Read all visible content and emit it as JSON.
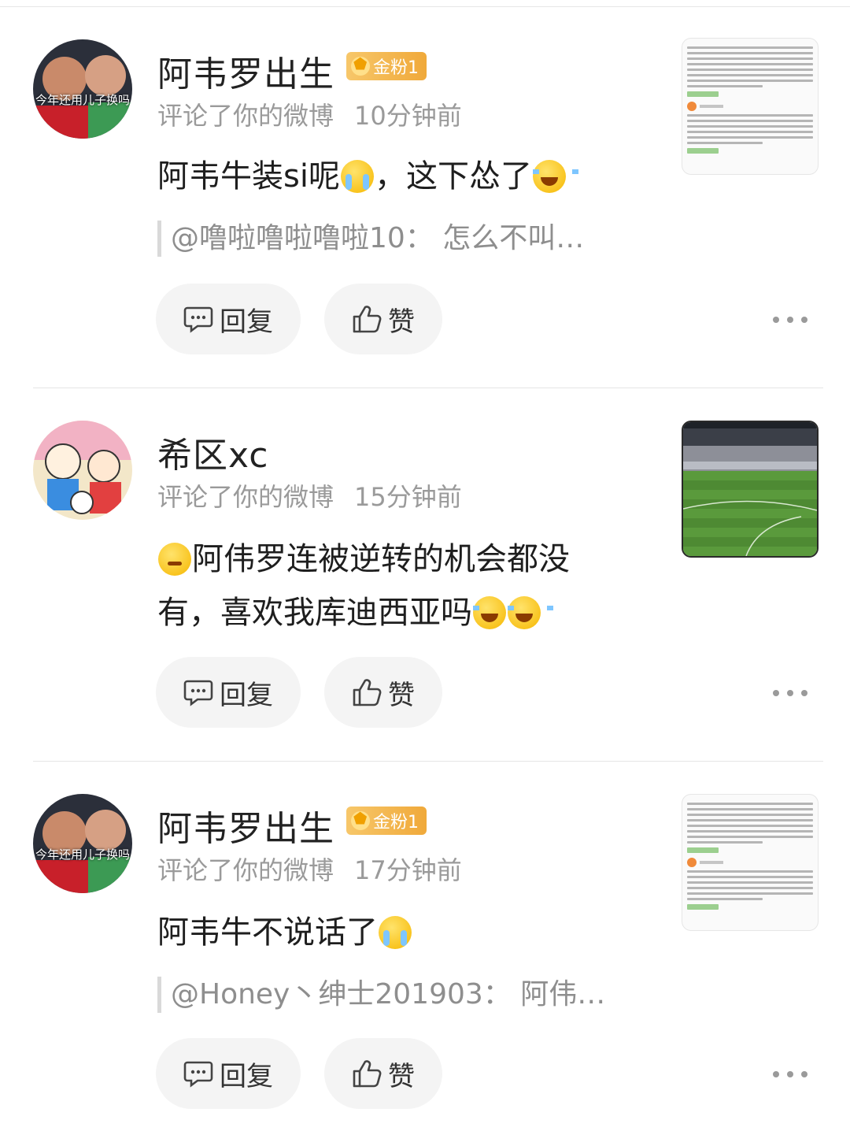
{
  "comments": [
    {
      "username": "阿韦罗出生",
      "badge": "金粉1",
      "action": "评论了你的微博",
      "time": "10分钟前",
      "text_parts": [
        "阿韦牛装si呢",
        "，这下怂了"
      ],
      "quote": "@噜啦噜啦噜啦10：  怎么不叫…",
      "avatar_caption": "今年还用儿子换吗"
    },
    {
      "username": "希区xc",
      "action": "评论了你的微博",
      "time": "15分钟前",
      "text_parts": [
        "阿伟罗连被逆转的机会都没有，喜欢我库迪西亚吗"
      ]
    },
    {
      "username": "阿韦罗出生",
      "badge": "金粉1",
      "action": "评论了你的微博",
      "time": "17分钟前",
      "text_parts": [
        "阿韦牛不说话了"
      ],
      "quote": "@Honey丶绅士201903：  阿伟…",
      "avatar_caption": "今年还用儿子换吗"
    }
  ],
  "actions": {
    "reply_label": "回复",
    "like_label": "赞"
  },
  "icons": [
    "comment-icon",
    "thumbs-up-icon",
    "more-icon"
  ],
  "colors": {
    "badge": "#f0a93a",
    "meta_text": "#9a9a9a",
    "pill_bg": "#f4f4f4"
  }
}
